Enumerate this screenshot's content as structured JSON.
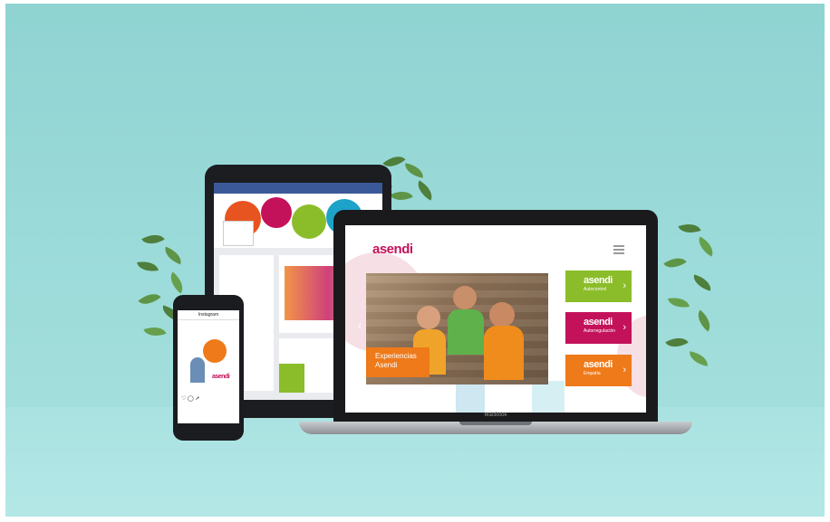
{
  "brand": {
    "logo": "asendi",
    "colors": {
      "green": "#8bbd2a",
      "magenta": "#c4125a",
      "orange": "#ee7a1a",
      "teal": "#96d6d5"
    }
  },
  "website": {
    "hero_caption": "Experiencias\nAsendi",
    "menu_icon": "hamburger-icon",
    "cards": [
      {
        "logo": "asendi",
        "label": "Autocontrol",
        "color": "#8bbd2a"
      },
      {
        "logo": "asendi",
        "label": "Autorregulación",
        "color": "#c4125a"
      },
      {
        "logo": "asendi",
        "label": "Empatía",
        "color": "#ee7a1a"
      }
    ]
  },
  "laptop": {
    "label": "MacBook"
  },
  "phone": {
    "app_title": "Instagram"
  }
}
